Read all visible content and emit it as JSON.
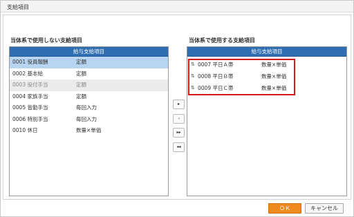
{
  "window": {
    "title": "支給項目"
  },
  "left_panel": {
    "label": "当体系で使用しない支給項目",
    "header": "給与支給項目",
    "rows": [
      {
        "code": "0001 役員報酬",
        "type": "定額",
        "state": "selected"
      },
      {
        "code": "0002 基本給",
        "type": "定額",
        "state": "normal"
      },
      {
        "code": "0003 役付手当",
        "type": "定額",
        "state": "disabled"
      },
      {
        "code": "0004 家族手当",
        "type": "定額",
        "state": "normal"
      },
      {
        "code": "0005 皆勤手当",
        "type": "毎回入力",
        "state": "normal"
      },
      {
        "code": "0006 特別手当",
        "type": "毎回入力",
        "state": "normal"
      },
      {
        "code": "0010 休日",
        "type": "数量×単価",
        "state": "normal"
      }
    ]
  },
  "right_panel": {
    "label": "当体系で使用する支給項目",
    "header": "給与支給項目",
    "rows": [
      {
        "code": "0007 平日Ａ帯",
        "type": "数量×単価"
      },
      {
        "code": "0008 平日Ｂ帯",
        "type": "数量×単価"
      },
      {
        "code": "0009 平日Ｃ帯",
        "type": "数量×単価"
      }
    ]
  },
  "move_buttons": {
    "add": "▸",
    "remove": "◂",
    "add_all": "▸▸",
    "remove_all": "◂◂"
  },
  "footer": {
    "ok_label": "ＯＫ",
    "cancel_label": "キャンセル"
  },
  "colors": {
    "header_blue": "#2f6fb1",
    "selected_row": "#b7d5f2",
    "ok_orange": "#f08a1e",
    "highlight_red": "#d7161e"
  }
}
